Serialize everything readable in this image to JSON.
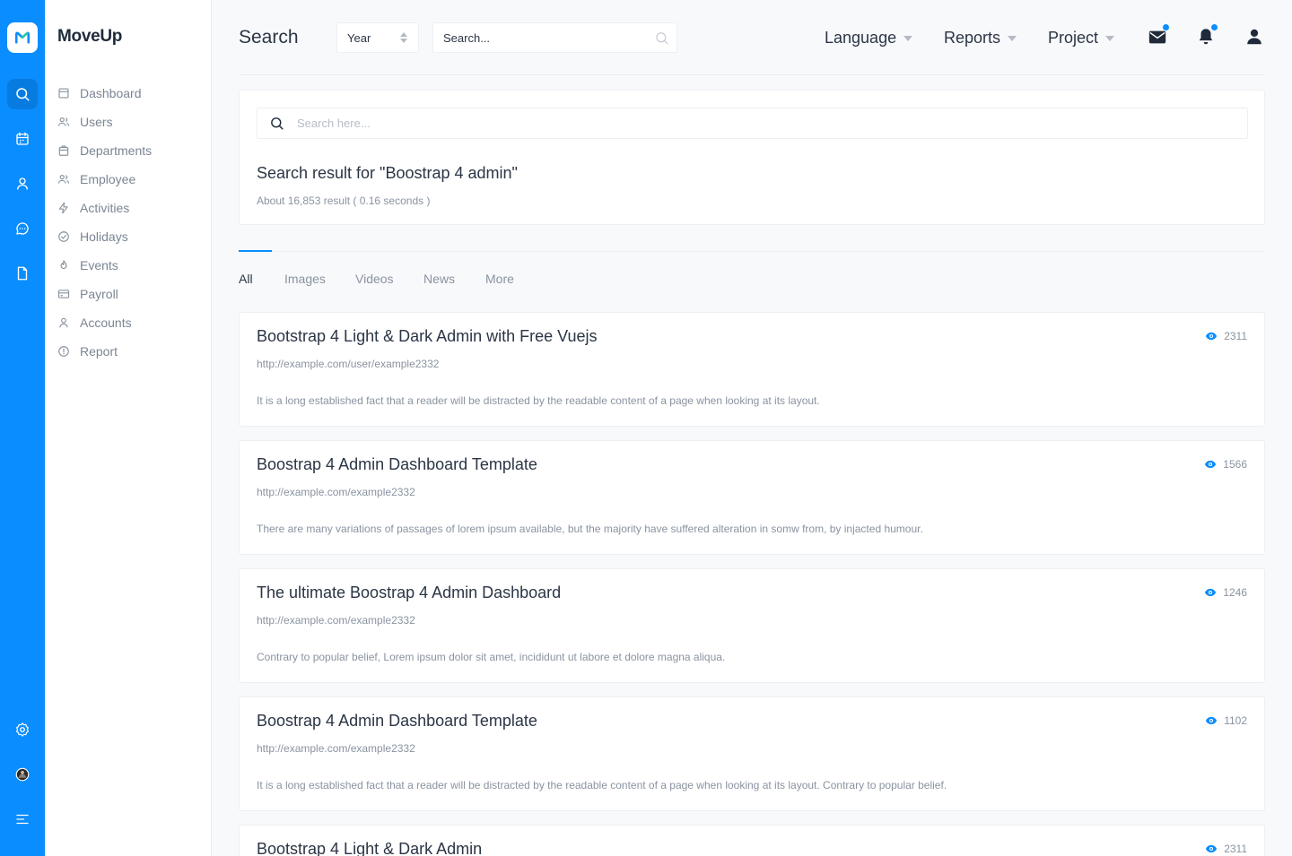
{
  "app": {
    "brand": "MoveUp"
  },
  "sidebar": {
    "items": [
      {
        "label": "Dashboard",
        "icon": "dashboard-icon"
      },
      {
        "label": "Users",
        "icon": "users-icon"
      },
      {
        "label": "Departments",
        "icon": "departments-icon"
      },
      {
        "label": "Employee",
        "icon": "employee-icon"
      },
      {
        "label": "Activities",
        "icon": "bolt-icon"
      },
      {
        "label": "Holidays",
        "icon": "check-circle-icon"
      },
      {
        "label": "Events",
        "icon": "fire-icon"
      },
      {
        "label": "Payroll",
        "icon": "credit-card-icon"
      },
      {
        "label": "Accounts",
        "icon": "user-icon"
      },
      {
        "label": "Report",
        "icon": "alert-circle-icon"
      }
    ]
  },
  "header": {
    "title": "Search",
    "year_value": "Year",
    "search_placeholder": "Search...",
    "menus": [
      "Language",
      "Reports",
      "Project"
    ]
  },
  "search": {
    "placeholder": "Search here...",
    "result_title": "Search result for \"Boostrap 4 admin\"",
    "result_meta": "About 16,853 result ( 0.16 seconds )"
  },
  "tabs": [
    "All",
    "Images",
    "Videos",
    "News",
    "More"
  ],
  "results": [
    {
      "title": "Bootstrap 4 Light & Dark Admin with Free Vuejs",
      "url": "http://example.com/user/example2332",
      "desc": "It is a long established fact that a reader will be distracted by the readable content of a page when looking at its layout.",
      "views": "2311"
    },
    {
      "title": "Boostrap 4 Admin Dashboard Template",
      "url": "http://example.com/example2332",
      "desc": "There are many variations of passages of lorem ipsum available, but the majority have suffered alteration in somw from, by injacted humour.",
      "views": "1566"
    },
    {
      "title": "The ultimate Boostrap 4 Admin Dashboard",
      "url": "http://example.com/example2332",
      "desc": "Contrary to popular belief, Lorem ipsum dolor sit amet, incididunt ut labore et dolore magna aliqua.",
      "views": "1246"
    },
    {
      "title": "Boostrap 4 Admin Dashboard Template",
      "url": "http://example.com/example2332",
      "desc": "It is a long established fact that a reader will be distracted by the readable content of a page when looking at its layout. Contrary to popular belief.",
      "views": "1102"
    },
    {
      "title": "Bootstrap 4 Light & Dark Admin",
      "url": "",
      "desc": "",
      "views": "2311"
    }
  ],
  "colors": {
    "accent": "#0a8dff",
    "text": "#2b3545",
    "muted": "#8a93a0"
  }
}
